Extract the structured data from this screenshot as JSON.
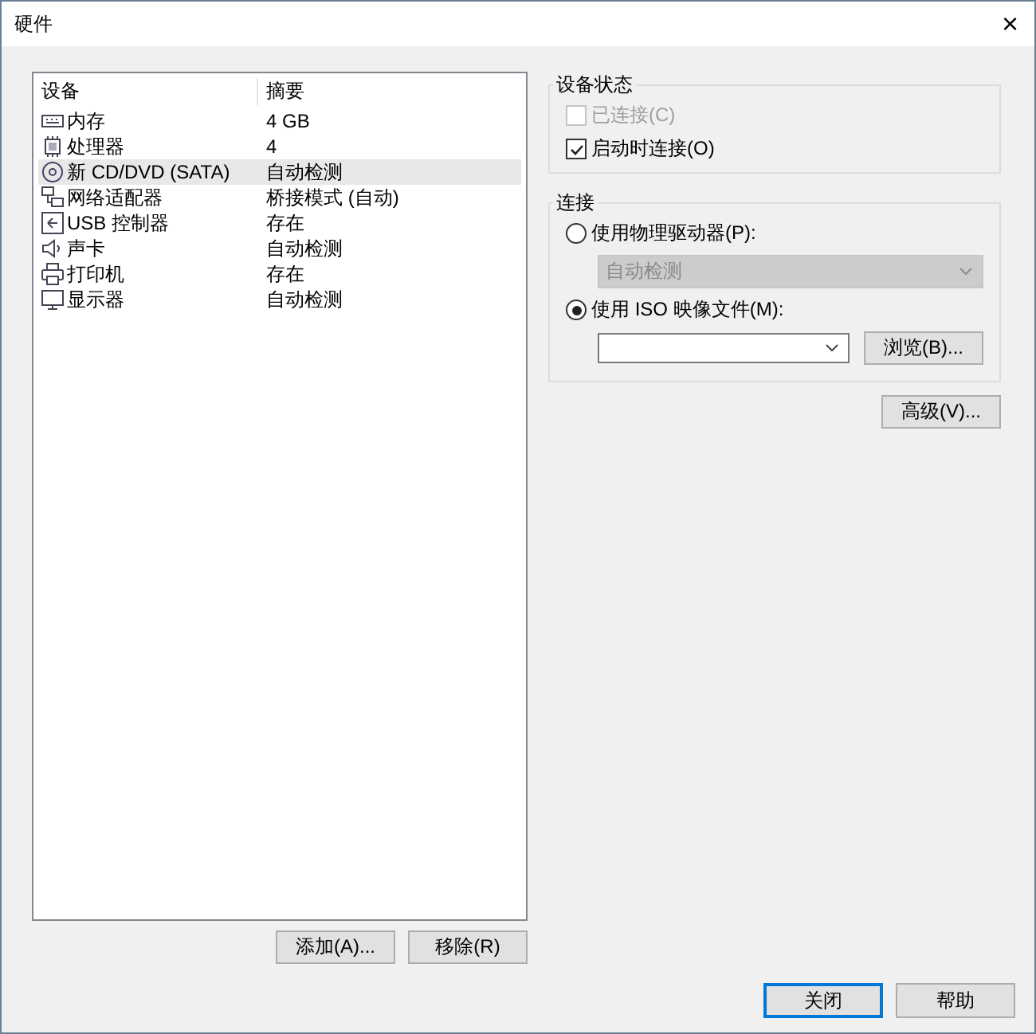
{
  "window": {
    "title": "硬件",
    "close": "×"
  },
  "device_list": {
    "columns": [
      "设备",
      "摘要"
    ],
    "rows": [
      {
        "kind": "memory",
        "device": "内存",
        "summary": "4 GB",
        "selected": false
      },
      {
        "kind": "cpu",
        "device": "处理器",
        "summary": "4",
        "selected": false
      },
      {
        "kind": "cd",
        "device": "新 CD/DVD (SATA)",
        "summary": "自动检测",
        "selected": true
      },
      {
        "kind": "network",
        "device": "网络适配器",
        "summary": "桥接模式 (自动)",
        "selected": false
      },
      {
        "kind": "usb",
        "device": "USB 控制器",
        "summary": "存在",
        "selected": false
      },
      {
        "kind": "sound",
        "device": "声卡",
        "summary": "自动检测",
        "selected": false
      },
      {
        "kind": "printer",
        "device": "打印机",
        "summary": "存在",
        "selected": false
      },
      {
        "kind": "display",
        "device": "显示器",
        "summary": "自动检测",
        "selected": false
      }
    ]
  },
  "list_buttons": [
    "添加(A)...",
    "移除(R)"
  ],
  "device_status": {
    "title": "设备状态",
    "options": [
      {
        "label": "已连接(C)",
        "checked": false,
        "disabled": true
      },
      {
        "label": "启动时连接(O)",
        "checked": true,
        "disabled": false
      }
    ]
  },
  "connection": {
    "title": "连接",
    "options": [
      {
        "label": "使用物理驱动器(P):",
        "selected": false,
        "kind": "dropdown",
        "value": "自动检测",
        "disabled": true
      },
      {
        "label": "使用 ISO 映像文件(M):",
        "selected": true,
        "kind": "combo",
        "button": "浏览(B)..."
      }
    ]
  },
  "advanced_button": "高级(V)...",
  "footer_buttons": [
    {
      "label": "关闭",
      "focused": true
    },
    {
      "label": "帮助",
      "focused": false
    }
  ]
}
